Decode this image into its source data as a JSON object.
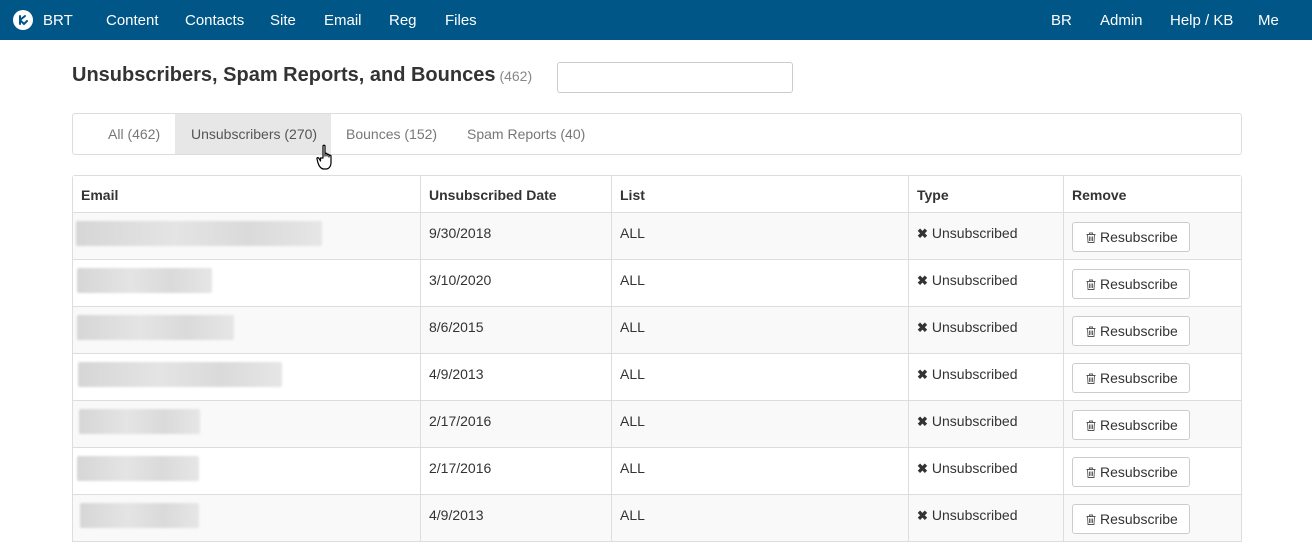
{
  "nav": {
    "brand": "BRT",
    "left_links": [
      "Content",
      "Contacts",
      "Site",
      "Email",
      "Reg",
      "Files"
    ],
    "right_links": [
      "BR",
      "Admin",
      "Help / KB",
      "Me"
    ],
    "bar_color": "#005687"
  },
  "page": {
    "title": "Unsubscribers, Spam Reports, and Bounces",
    "count": "(462)",
    "search_placeholder": "",
    "search_value": ""
  },
  "tabs": [
    {
      "label": "All (462)",
      "active": false
    },
    {
      "label": "Unsubscribers (270)",
      "active": true
    },
    {
      "label": "Bounces (152)",
      "active": false
    },
    {
      "label": "Spam Reports (40)",
      "active": false
    }
  ],
  "table": {
    "headers": [
      "Email",
      "Unsubscribed Date",
      "List",
      "Type",
      "Remove"
    ],
    "rows": [
      {
        "email": "",
        "date": "9/30/2018",
        "list": "ALL",
        "type": "Unsubscribed",
        "action": "Resubscribe"
      },
      {
        "email": "",
        "date": "3/10/2020",
        "list": "ALL",
        "type": "Unsubscribed",
        "action": "Resubscribe"
      },
      {
        "email": "",
        "date": "8/6/2015",
        "list": "ALL",
        "type": "Unsubscribed",
        "action": "Resubscribe"
      },
      {
        "email": "",
        "date": "4/9/2013",
        "list": "ALL",
        "type": "Unsubscribed",
        "action": "Resubscribe"
      },
      {
        "email": "",
        "date": "2/17/2016",
        "list": "ALL",
        "type": "Unsubscribed",
        "action": "Resubscribe"
      },
      {
        "email": "",
        "date": "2/17/2016",
        "list": "ALL",
        "type": "Unsubscribed",
        "action": "Resubscribe"
      },
      {
        "email": "",
        "date": "4/9/2013",
        "list": "ALL",
        "type": "Unsubscribed",
        "action": "Resubscribe"
      }
    ]
  },
  "icons": {
    "brand": "logo-icon",
    "type": "x-icon",
    "button": "trash-icon",
    "pointer": "hand-cursor-icon"
  }
}
